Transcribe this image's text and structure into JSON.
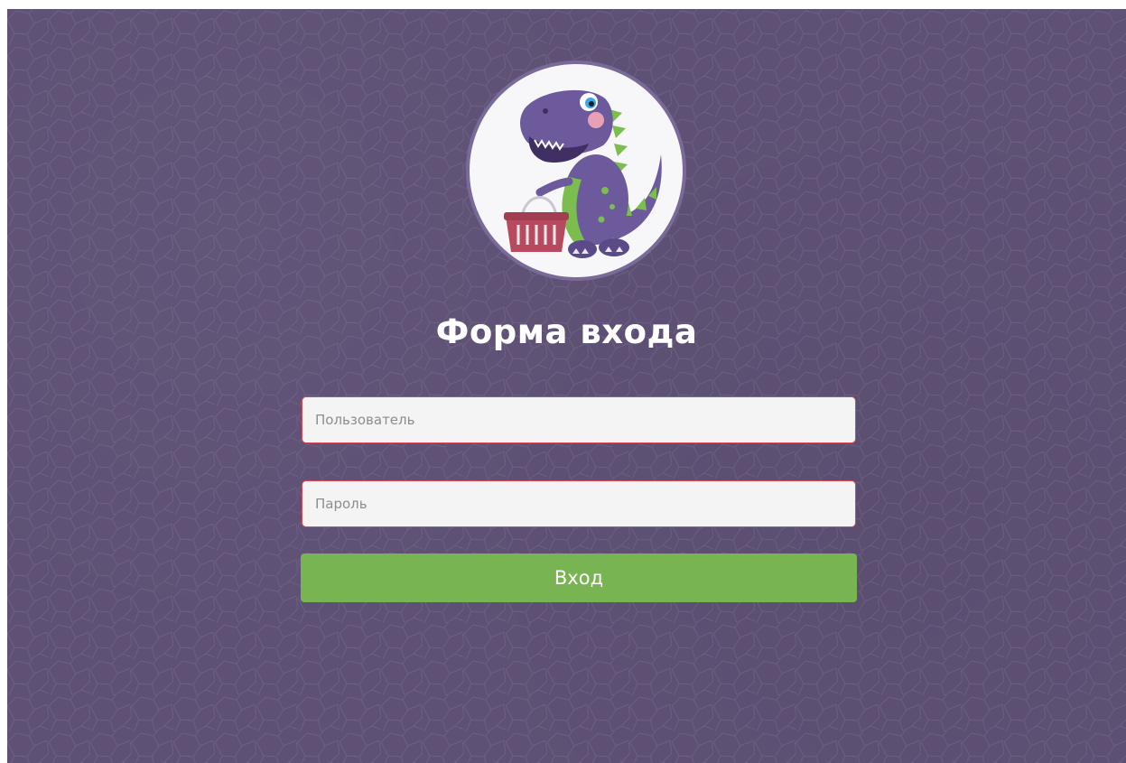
{
  "page": {
    "title": "Форма входа"
  },
  "form": {
    "username_placeholder": "Пользователь",
    "username_value": "",
    "password_placeholder": "Пароль",
    "password_value": "",
    "submit_label": "Вход"
  },
  "logo": {
    "icon": "dinosaur-with-basket-icon"
  },
  "colors": {
    "background": "#5e5175",
    "button": "#79b453",
    "field_border": "#d84a55",
    "title": "#ffffff"
  }
}
